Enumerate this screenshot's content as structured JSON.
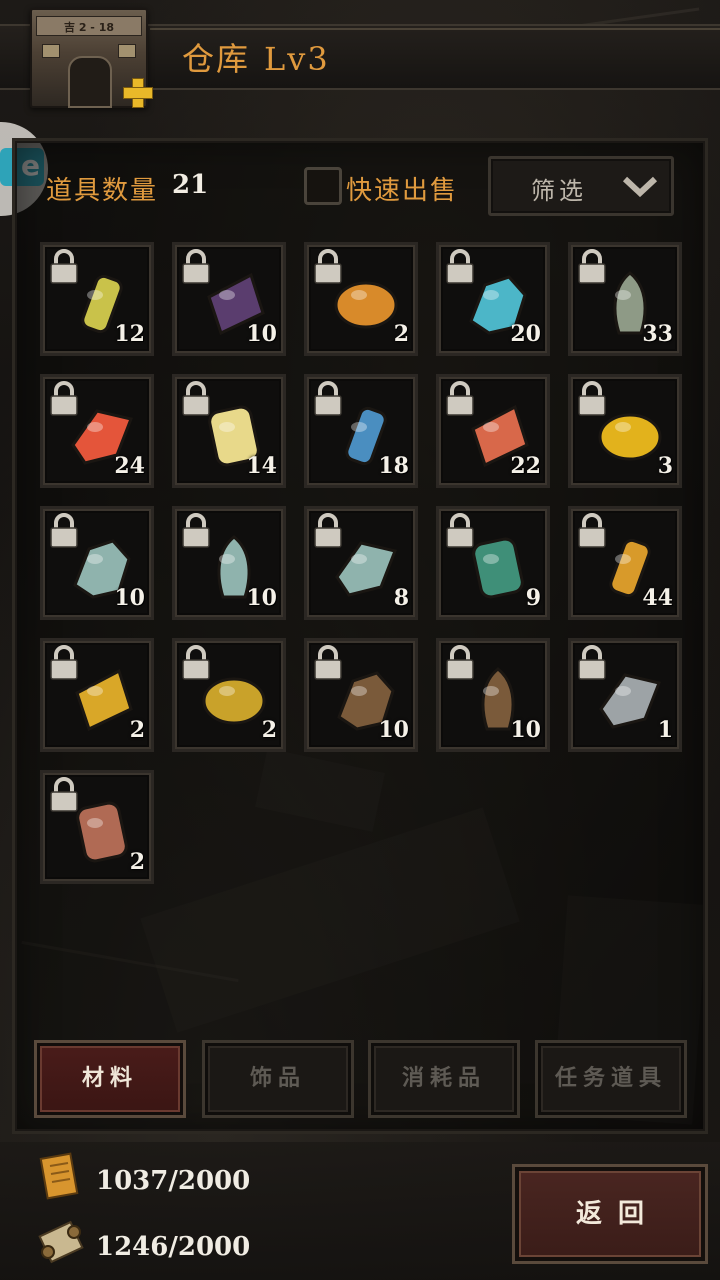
{
  "header": {
    "title": "仓库",
    "level": "Lv3",
    "building_sign": "吉 2 - 18",
    "building_icon": "warehouse-building-icon",
    "upgrade_icon": "plus-icon"
  },
  "toolbar": {
    "count_label": "道具数量",
    "count_value": "21",
    "quick_sell_label": "快速出售",
    "quick_sell_checked": false,
    "filter_label": "筛选"
  },
  "items": [
    {
      "name": "potion-bottle",
      "qty": "12",
      "locked": true,
      "color": "#c9c24a"
    },
    {
      "name": "purple-book",
      "qty": "10",
      "locked": true,
      "color": "#5a3d6e"
    },
    {
      "name": "sos-bottle",
      "qty": "2",
      "locked": true,
      "color": "#d88a2a"
    },
    {
      "name": "blue-mushroom",
      "qty": "20",
      "locked": true,
      "color": "#4cb6c8"
    },
    {
      "name": "mossy-ore",
      "qty": "33",
      "locked": true,
      "color": "#8e9a86"
    },
    {
      "name": "fire-crystal",
      "qty": "24",
      "locked": true,
      "color": "#e4553a"
    },
    {
      "name": "lightning-crystal",
      "qty": "14",
      "locked": true,
      "color": "#e8d98a"
    },
    {
      "name": "blue-scale",
      "qty": "18",
      "locked": true,
      "color": "#4a8ec0"
    },
    {
      "name": "red-stone",
      "qty": "22",
      "locked": true,
      "color": "#d8684a"
    },
    {
      "name": "gold-scroll",
      "qty": "3",
      "locked": true,
      "color": "#e2b21c"
    },
    {
      "name": "silver-ore",
      "qty": "10",
      "locked": true,
      "color": "#8fb3ad"
    },
    {
      "name": "silver-ore",
      "qty": "10",
      "locked": true,
      "color": "#8fb3ad"
    },
    {
      "name": "silver-ore",
      "qty": "8",
      "locked": true,
      "color": "#8fb3ad"
    },
    {
      "name": "emerald-ore",
      "qty": "9",
      "locked": true,
      "color": "#3f8f78"
    },
    {
      "name": "gold-nugget",
      "qty": "44",
      "locked": true,
      "color": "#d89a2a"
    },
    {
      "name": "gold-gourd",
      "qty": "2",
      "locked": true,
      "color": "#d9a728"
    },
    {
      "name": "gold-turtle",
      "qty": "2",
      "locked": true,
      "color": "#c9a22a"
    },
    {
      "name": "bronze-tablet",
      "qty": "10",
      "locked": true,
      "color": "#7a5a3a"
    },
    {
      "name": "bronze-tablet",
      "qty": "10",
      "locked": true,
      "color": "#7a5a3a"
    },
    {
      "name": "silver-charm",
      "qty": "1",
      "locked": true,
      "color": "#9da3a6"
    },
    {
      "name": "copper-tablet",
      "qty": "2",
      "locked": true,
      "color": "#b06a54"
    }
  ],
  "tabs": [
    {
      "label": "材料",
      "active": true
    },
    {
      "label": "饰品",
      "active": false
    },
    {
      "label": "消耗品",
      "active": false
    },
    {
      "label": "任务道具",
      "active": false
    }
  ],
  "resources": [
    {
      "icon": "gold-scroll-icon",
      "value": "1037/2000",
      "color": "#e0a23a"
    },
    {
      "icon": "map-scroll-icon",
      "value": "1246/2000",
      "color": "#c9b890"
    }
  ],
  "back_label": "返回",
  "colors": {
    "accent": "#e09a3e",
    "tab_active": "#4a1c1a",
    "panel_border": "#2c2822"
  }
}
